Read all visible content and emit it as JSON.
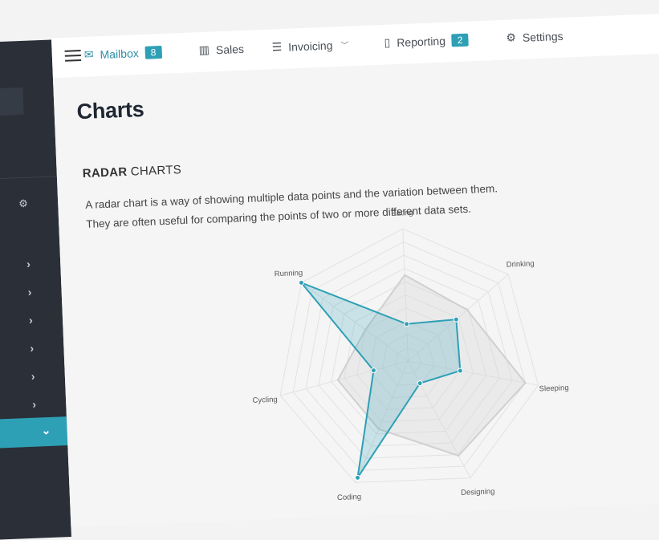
{
  "nav": {
    "items": [
      {
        "label": "Mailbox",
        "badge": "8",
        "icon": "mail-icon",
        "active": true
      },
      {
        "label": "Sales",
        "icon": "bar-chart-icon"
      },
      {
        "label": "Invoicing",
        "icon": "list-icon",
        "dropdown": true
      },
      {
        "label": "Reporting",
        "badge": "2",
        "icon": "book-icon"
      },
      {
        "label": "Settings",
        "icon": "gear-icon"
      }
    ]
  },
  "page": {
    "title": "Charts",
    "section_bold": "RADAR",
    "section_rest": " CHARTS",
    "desc_line1": "A radar chart is a way of showing multiple data points and the variation between them.",
    "desc_line2": "They are often useful for comparing the points of two or more different data sets."
  },
  "colors": {
    "accent": "#2ea0b6",
    "sidebar": "#2a2f38"
  },
  "chart_data": {
    "type": "radar",
    "categories": [
      "Eating",
      "Drinking",
      "Sleeping",
      "Designing",
      "Coding",
      "Cycling",
      "Running"
    ],
    "series": [
      {
        "values": [
          65,
          59,
          90,
          81,
          56,
          55,
          40
        ],
        "color": "#dcdcdc"
      },
      {
        "values": [
          28,
          48,
          40,
          19,
          96,
          27,
          100
        ],
        "color": "#2ea0b6"
      }
    ],
    "range": [
      0,
      100
    ]
  }
}
